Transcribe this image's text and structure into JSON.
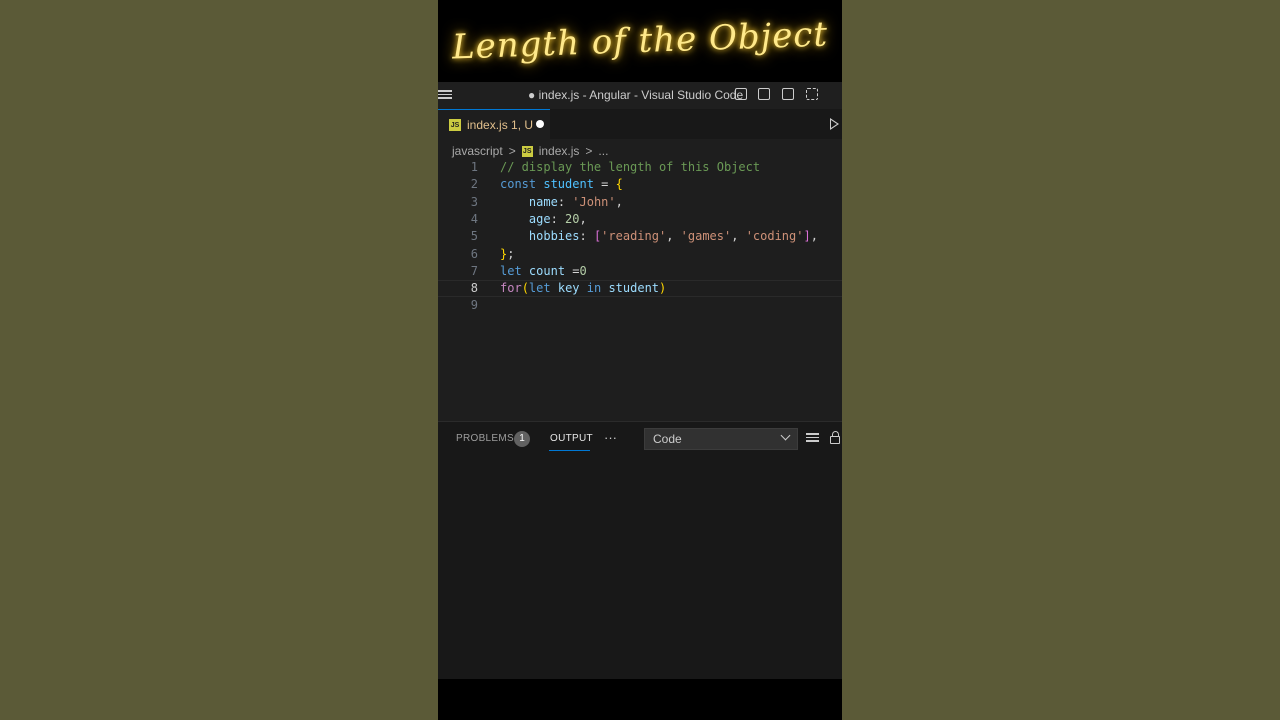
{
  "banner": {
    "title": "Length of the Object"
  },
  "window": {
    "title": "● index.js - Angular - Visual Studio Code",
    "menu_icon": "hamburger-menu-icon",
    "layout_icons": [
      "toggle-primary-sidebar-icon",
      "toggle-panel-icon",
      "toggle-secondary-sidebar-icon",
      "customize-layout-icon"
    ]
  },
  "tab": {
    "icon": "js-file-icon",
    "icon_text": "JS",
    "label": "index.js 1, U",
    "dirty": true
  },
  "breadcrumb": {
    "folder": "javascript",
    "sep": ">",
    "file": "index.js",
    "sep2": ">",
    "tail": "..."
  },
  "editor": {
    "lines": [
      {
        "n": "1",
        "tokens": [
          {
            "t": "// display the length of this Object",
            "c": "#6a9955"
          }
        ]
      },
      {
        "n": "2",
        "tokens": [
          {
            "t": "const",
            "c": "#569cd6"
          },
          {
            "t": " ",
            "c": "#d4d4d4"
          },
          {
            "t": "student",
            "c": "#4fc1ff"
          },
          {
            "t": " = ",
            "c": "#d4d4d4"
          },
          {
            "t": "{",
            "c": "#ffd700"
          }
        ]
      },
      {
        "n": "3",
        "tokens": [
          {
            "t": "    ",
            "c": "#d4d4d4"
          },
          {
            "t": "name",
            "c": "#9cdcfe"
          },
          {
            "t": ": ",
            "c": "#d4d4d4"
          },
          {
            "t": "'John'",
            "c": "#ce9178"
          },
          {
            "t": ",",
            "c": "#d4d4d4"
          }
        ]
      },
      {
        "n": "4",
        "tokens": [
          {
            "t": "    ",
            "c": "#d4d4d4"
          },
          {
            "t": "age",
            "c": "#9cdcfe"
          },
          {
            "t": ": ",
            "c": "#d4d4d4"
          },
          {
            "t": "20",
            "c": "#b5cea8"
          },
          {
            "t": ",",
            "c": "#d4d4d4"
          }
        ]
      },
      {
        "n": "5",
        "tokens": [
          {
            "t": "    ",
            "c": "#d4d4d4"
          },
          {
            "t": "hobbies",
            "c": "#9cdcfe"
          },
          {
            "t": ": ",
            "c": "#d4d4d4"
          },
          {
            "t": "[",
            "c": "#da70d6"
          },
          {
            "t": "'reading'",
            "c": "#ce9178"
          },
          {
            "t": ", ",
            "c": "#d4d4d4"
          },
          {
            "t": "'games'",
            "c": "#ce9178"
          },
          {
            "t": ", ",
            "c": "#d4d4d4"
          },
          {
            "t": "'coding'",
            "c": "#ce9178"
          },
          {
            "t": "]",
            "c": "#da70d6"
          },
          {
            "t": ",",
            "c": "#d4d4d4"
          }
        ]
      },
      {
        "n": "6",
        "tokens": [
          {
            "t": "}",
            "c": "#ffd700"
          },
          {
            "t": ";",
            "c": "#d4d4d4"
          }
        ]
      },
      {
        "n": "7",
        "tokens": [
          {
            "t": "let",
            "c": "#569cd6"
          },
          {
            "t": " ",
            "c": "#d4d4d4"
          },
          {
            "t": "count",
            "c": "#9cdcfe"
          },
          {
            "t": " =",
            "c": "#d4d4d4"
          },
          {
            "t": "0",
            "c": "#b5cea8"
          }
        ]
      },
      {
        "n": "8",
        "current": true,
        "tokens": [
          {
            "t": "for",
            "c": "#c586c0"
          },
          {
            "t": "(",
            "c": "#ffd700"
          },
          {
            "t": "let",
            "c": "#569cd6"
          },
          {
            "t": " ",
            "c": "#d4d4d4"
          },
          {
            "t": "key",
            "c": "#9cdcfe"
          },
          {
            "t": " ",
            "c": "#d4d4d4"
          },
          {
            "t": "in",
            "c": "#569cd6"
          },
          {
            "t": " ",
            "c": "#d4d4d4"
          },
          {
            "t": "student",
            "c": "#9cdcfe"
          },
          {
            "t": ")",
            "c": "#ffd700"
          }
        ]
      },
      {
        "n": "9",
        "tokens": []
      }
    ]
  },
  "panel": {
    "problems_label": "PROBLEMS",
    "problems_count": "1",
    "output_label": "OUTPUT",
    "more_label": "···",
    "channel_select": "Code",
    "icons": [
      "clear-output-icon",
      "lock-scroll-icon"
    ]
  },
  "colors": {
    "accent": "#0078d4",
    "tab_modified": "#e2c08d",
    "banner_glow": "#ffd23a"
  }
}
